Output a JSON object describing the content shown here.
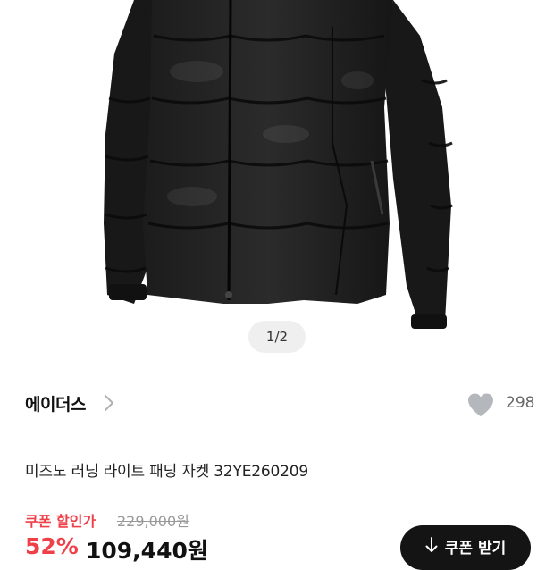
{
  "gallery": {
    "pager_text": "1/2",
    "image_subject": "black padded jacket"
  },
  "brand": {
    "name": "에이더스",
    "like_count": "298",
    "icons": [
      "chevron-right-icon",
      "heart-icon"
    ]
  },
  "product": {
    "title": "미즈노 러닝 라이트 패딩 자켓 32YE260209"
  },
  "price": {
    "coupon_label": "쿠폰 할인가",
    "original_price": "229,000원",
    "discount_rate": "52%",
    "sale_price": "109,440원"
  },
  "coupon_button": {
    "label": "쿠폰 받기",
    "icon": "download-arrow-icon"
  },
  "colors": {
    "accent_red": "#ef3f48",
    "button_dark": "#141414",
    "heart_gray": "#b4b8bc"
  }
}
